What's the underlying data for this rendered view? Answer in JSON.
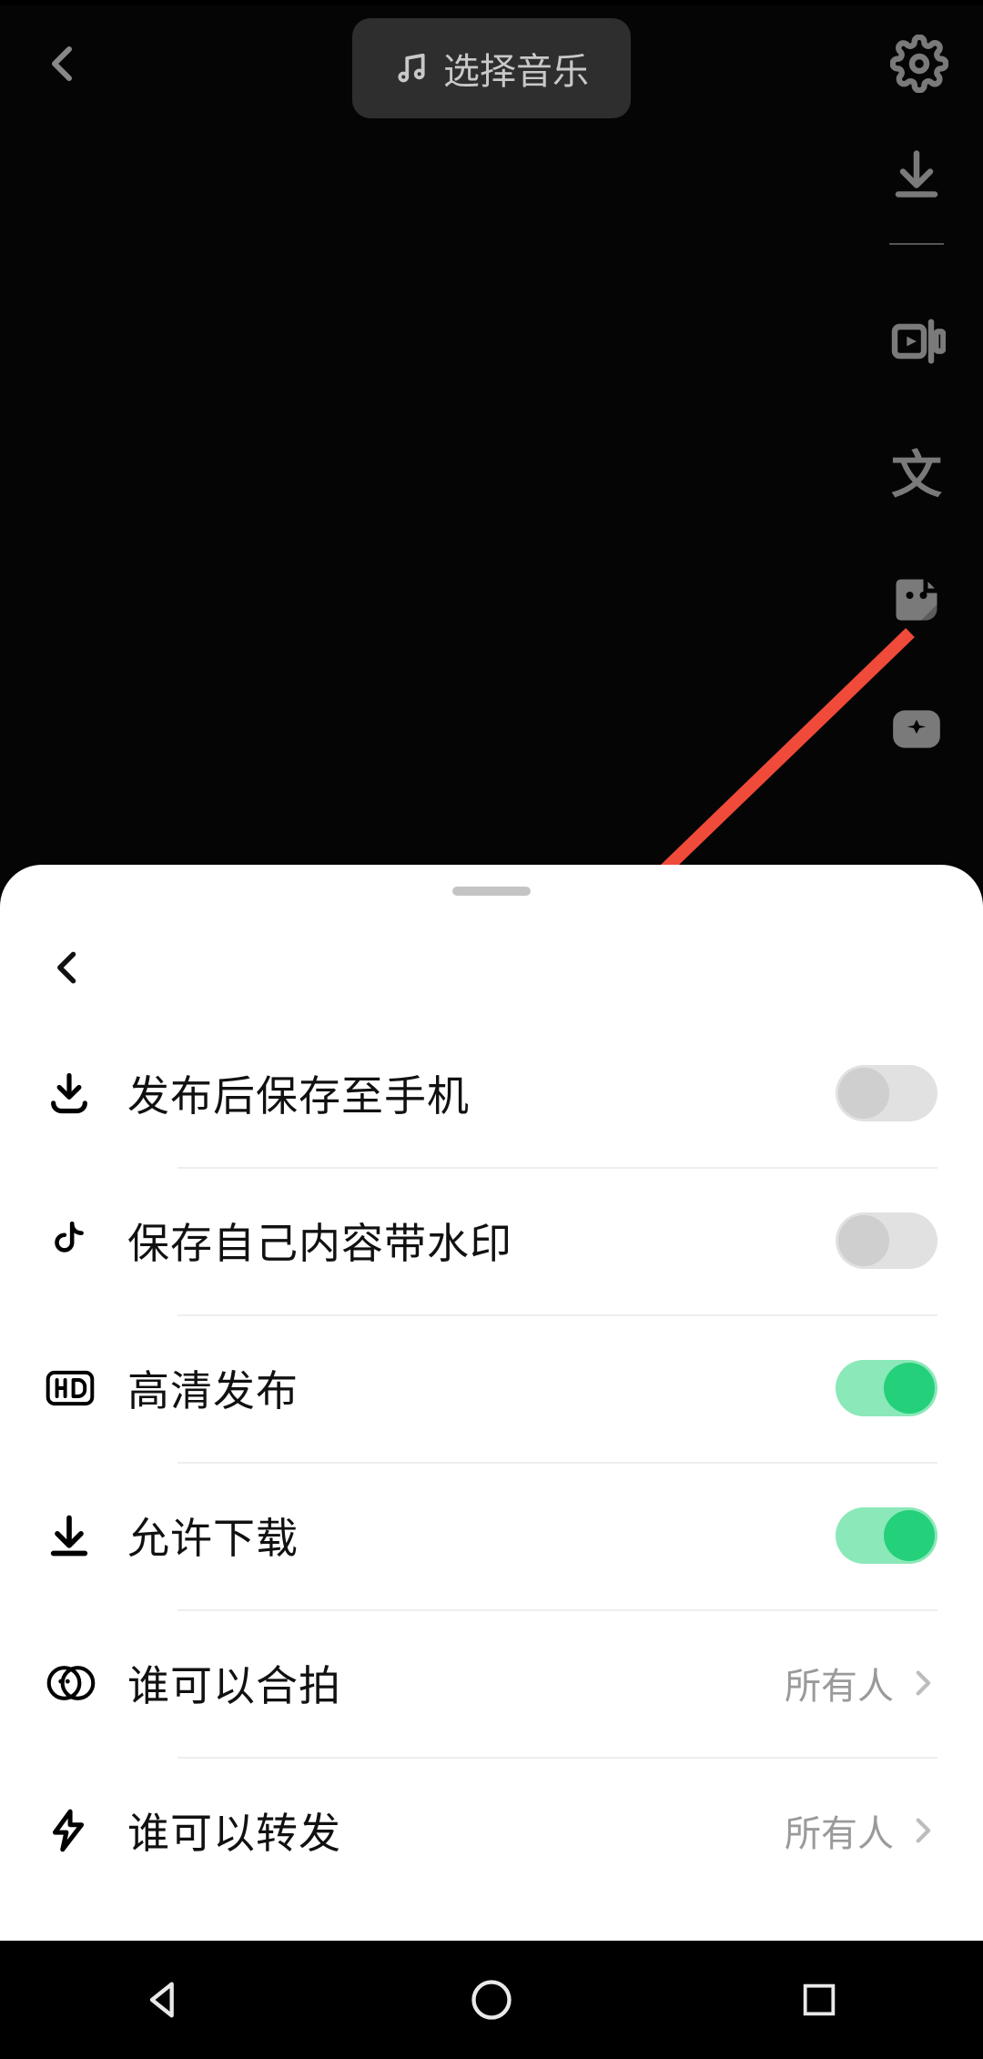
{
  "header": {
    "music_label": "选择音乐"
  },
  "side_tools": {
    "tool1": "download-icon",
    "tool2": "video-template-icon",
    "tool3_text": "文",
    "tool4": "sticker-icon",
    "tool5": "effects-icon"
  },
  "sheet": {
    "rows": [
      {
        "icon": "save-to-phone-icon",
        "label": "发布后保存至手机",
        "type": "toggle",
        "on": false
      },
      {
        "icon": "douyin-icon",
        "label": "保存自己内容带水印",
        "type": "toggle",
        "on": false
      },
      {
        "icon": "hd-icon",
        "label": "高清发布",
        "type": "toggle",
        "on": true
      },
      {
        "icon": "download-icon",
        "label": "允许下载",
        "type": "toggle",
        "on": true
      },
      {
        "icon": "duet-icon",
        "label": "谁可以合拍",
        "type": "link",
        "value": "所有人"
      },
      {
        "icon": "forward-icon",
        "label": "谁可以转发",
        "type": "link",
        "value": "所有人"
      }
    ]
  },
  "annotation": {
    "arrow_color": "#f04a3a"
  }
}
